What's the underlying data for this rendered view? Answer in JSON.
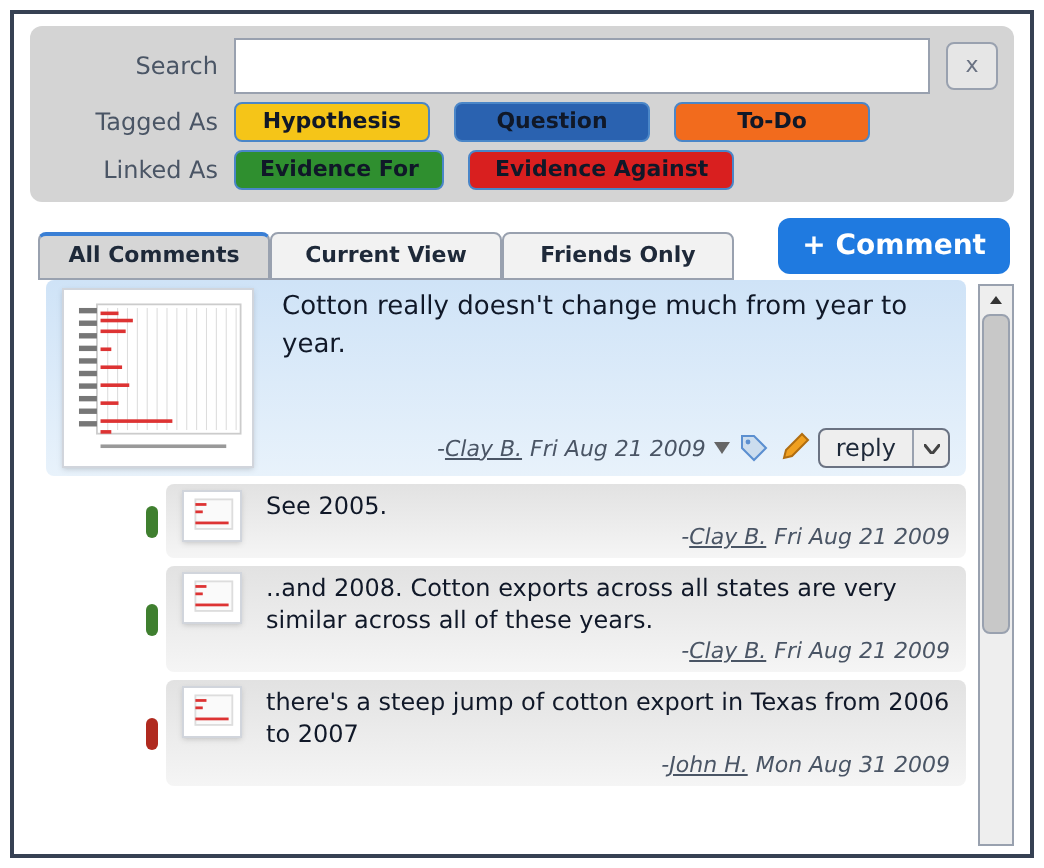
{
  "filters": {
    "search": {
      "label": "Search"
    },
    "clear_button": "x",
    "tag_rows": [
      {
        "label": "Tagged As",
        "tags": [
          {
            "label": "Hypothesis",
            "color": "#f5c518"
          },
          {
            "label": "Question",
            "color": "#2a62b0"
          },
          {
            "label": "To-Do",
            "color": "#f26b1d"
          }
        ]
      },
      {
        "label": "Linked As",
        "tags": [
          {
            "label": "Evidence For",
            "color": "#2f8f2f"
          },
          {
            "label": "Evidence Against",
            "color": "#d91f1f"
          }
        ]
      }
    ]
  },
  "tabs": [
    {
      "label": "All Comments",
      "selected": true
    },
    {
      "label": "Current View",
      "selected": false
    },
    {
      "label": "Friends Only",
      "selected": false
    }
  ],
  "add_comment_button": "+ Comment",
  "comment": {
    "text": "Cotton really doesn't change much from year to year.",
    "dash": "-",
    "author": "Clay B.",
    "date": "Fri Aug 21 2009",
    "reply_button": "reply",
    "replies": [
      {
        "text": "See 2005.",
        "dash": "-",
        "author": "Clay B.",
        "date": "Fri Aug 21 2009",
        "color": "#3f7f2f"
      },
      {
        "text": "..and 2008. Cotton exports across all states are very similar across all of these years.",
        "dash": "-",
        "author": "Clay B.",
        "date": "Fri Aug 21 2009",
        "color": "#3f7f2f"
      },
      {
        "text": "there's a steep jump of cotton export in Texas from 2006 to 2007",
        "dash": "-",
        "author": "John H.",
        "date": "Mon Aug 31 2009",
        "color": "#b02a1f"
      }
    ]
  }
}
